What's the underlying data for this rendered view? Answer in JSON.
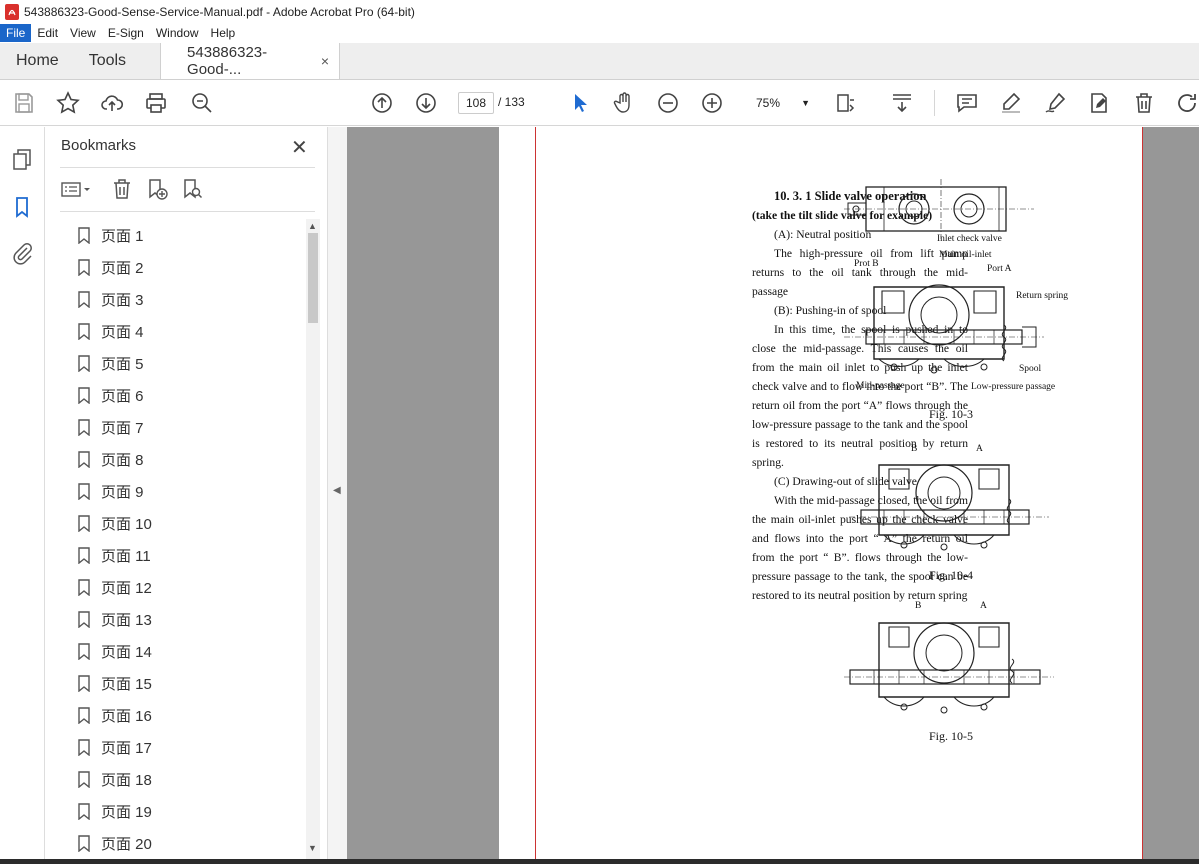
{
  "window": {
    "title": "543886323-Good-Sense-Service-Manual.pdf - Adobe Acrobat Pro (64-bit)"
  },
  "menu": [
    "File",
    "Edit",
    "View",
    "E-Sign",
    "Window",
    "Help"
  ],
  "tabs": {
    "home": "Home",
    "tools": "Tools",
    "doc": "543886323-Good-...",
    "close": "×"
  },
  "toolbar": {
    "page_current": "108",
    "page_total": "/ 133",
    "zoom": "75%"
  },
  "bookmarks": {
    "title": "Bookmarks",
    "close": "✕",
    "items": [
      "页面 1",
      "页面 2",
      "页面 3",
      "页面 4",
      "页面 5",
      "页面 6",
      "页面 7",
      "页面 8",
      "页面 9",
      "页面 10",
      "页面 11",
      "页面 12",
      "页面 13",
      "页面 14",
      "页面 15",
      "页面 16",
      "页面 17",
      "页面 18",
      "页面 19",
      "页面 20"
    ]
  },
  "document": {
    "heading": "10. 3. 1  Slide  valve  operation",
    "subheading": "(take  the  tilt  slide  valve  for  example)",
    "a_title": "(A):  Neutral  position",
    "a_body": "The high-pressure oil from lift pump returns to the oil tank through the mid-passage",
    "b_title": "(B):  Pushing-in  of  spool",
    "b_body": "In this time, the spool is pushed in to close the mid-passage. This causes the oil from the main oil inlet to push up the inlet check valve and to flow into the port “B”. The return oil from the port “A” flows through the low-pressure passage to the tank and the spool is restored to its neutral position by return spring.",
    "c_title": "(C)  Drawing-out  of  slide valve",
    "c_body": "With the mid-passage closed, the oil from the main oil-inlet pushes up the check valve and flows into the port “ A” the return oil from the port “ B”. flows through the low-pressure passage to the tank, the spool can be restored to its neutral position by return spring",
    "fig3": {
      "caption": "Fig. 10-3",
      "labels": {
        "inlet_check": "Inlet check valve",
        "main_inlet": "Main oil-inlet",
        "prot_b": "Prot B",
        "port_a": "Port A",
        "return_spring": "Return spring",
        "spool": "Spool",
        "mid_passage": "Mid-passage",
        "low_pressure": "Low-pressure passage"
      }
    },
    "fig4": {
      "caption": "Fig. 10-4",
      "b": "B",
      "a": "A"
    },
    "fig5": {
      "caption": "Fig. 10-5",
      "b": "B",
      "a": "A"
    }
  }
}
